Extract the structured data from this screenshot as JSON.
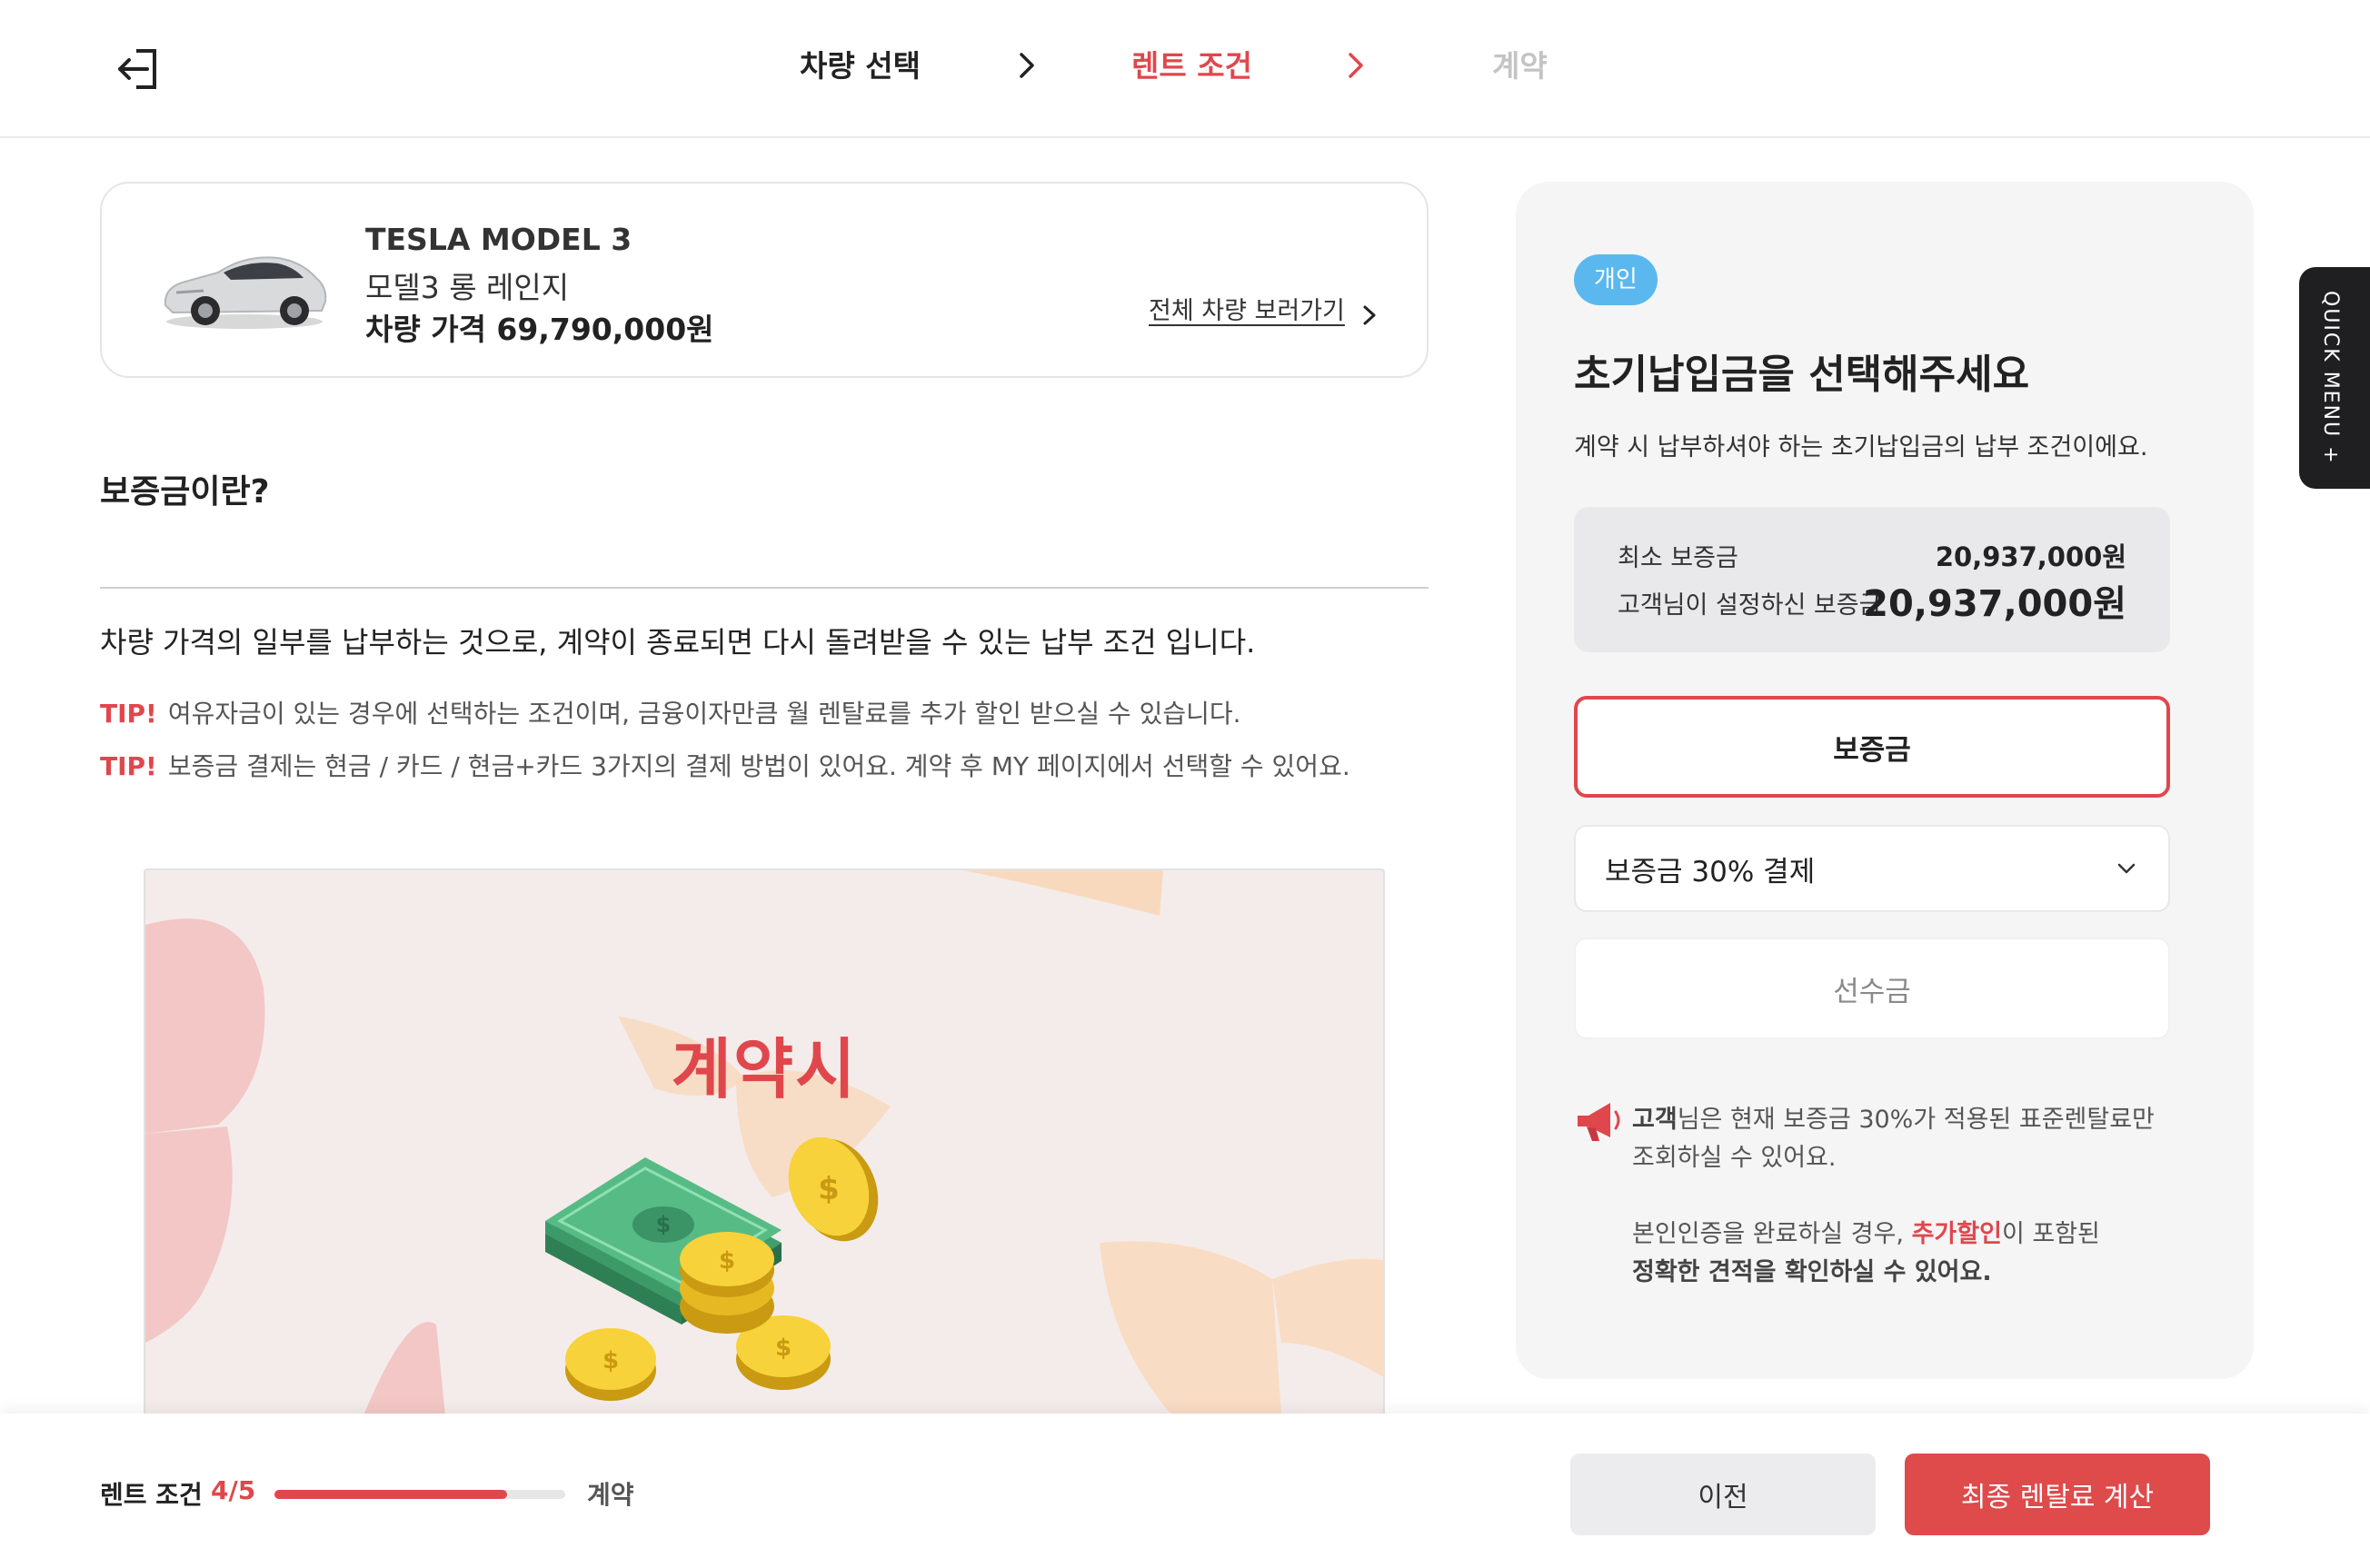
{
  "nav": {
    "steps": [
      {
        "label": "차량 선택"
      },
      {
        "label": "렌트 조건"
      },
      {
        "label": "계약"
      }
    ]
  },
  "car": {
    "name": "TESLA MODEL 3",
    "trim": "모델3 롱 레인지",
    "price": "차량 가격 69,790,000원",
    "view_all_link": "전체 차량 보러가기"
  },
  "deposit_info": {
    "title": "보증금이란?",
    "description": "차량 가격의 일부를 납부하는 것으로, 계약이 종료되면 다시 돌려받을 수 있는 납부 조건 입니다.",
    "tips": [
      {
        "label": "TIP!",
        "text": "여유자금이 있는 경우에 선택하는 조건이며, 금융이자만큼 월 렌탈료를 추가 할인 받으실 수 있습니다."
      },
      {
        "label": "TIP!",
        "text": "보증금 결제는 현금 / 카드 / 현금+카드 3가지의 결제 방법이 있어요. 계약 후 MY 페이지에서 선택할 수 있어요."
      }
    ],
    "illustration_text": "계약시"
  },
  "panel": {
    "badge": "개인",
    "title": "초기납입금을 선택해주세요",
    "subtitle": "계약 시 납부하셔야 하는 초기납입금의 납부 조건이에요.",
    "min_deposit_label": "최소 보증금",
    "min_deposit_value": "20,937,000원",
    "user_deposit_label": "고객님이 설정하신 보증금",
    "user_deposit_value": "20,937,000원",
    "option_deposit": "보증금",
    "option_select_value": "보증금 30% 결제",
    "option_prepay": "선수금",
    "notice": {
      "customer": "고객",
      "line1_rest": "님은 현재 보증금 30%가 적용된 표준렌탈료만 조회하실 수 있어요.",
      "line2_pre": "본인인증을 완료하실 경우, ",
      "line2_red": "추가할인",
      "line2_post": "이 포함된",
      "line3": "정확한 견적을 확인하실 수 있어요."
    }
  },
  "quick_menu": {
    "label": "QUICK MENU +"
  },
  "bottom": {
    "progress_label": "렌트 조건",
    "progress_count": "4/5",
    "progress_fraction": 0.8,
    "next_label": "계약",
    "prev_button": "이전",
    "calc_button": "최종 렌탈료 계산"
  },
  "colors": {
    "accent": "#e0474c",
    "badge": "#5bb8ee",
    "panel_bg": "#f5f5f6"
  }
}
